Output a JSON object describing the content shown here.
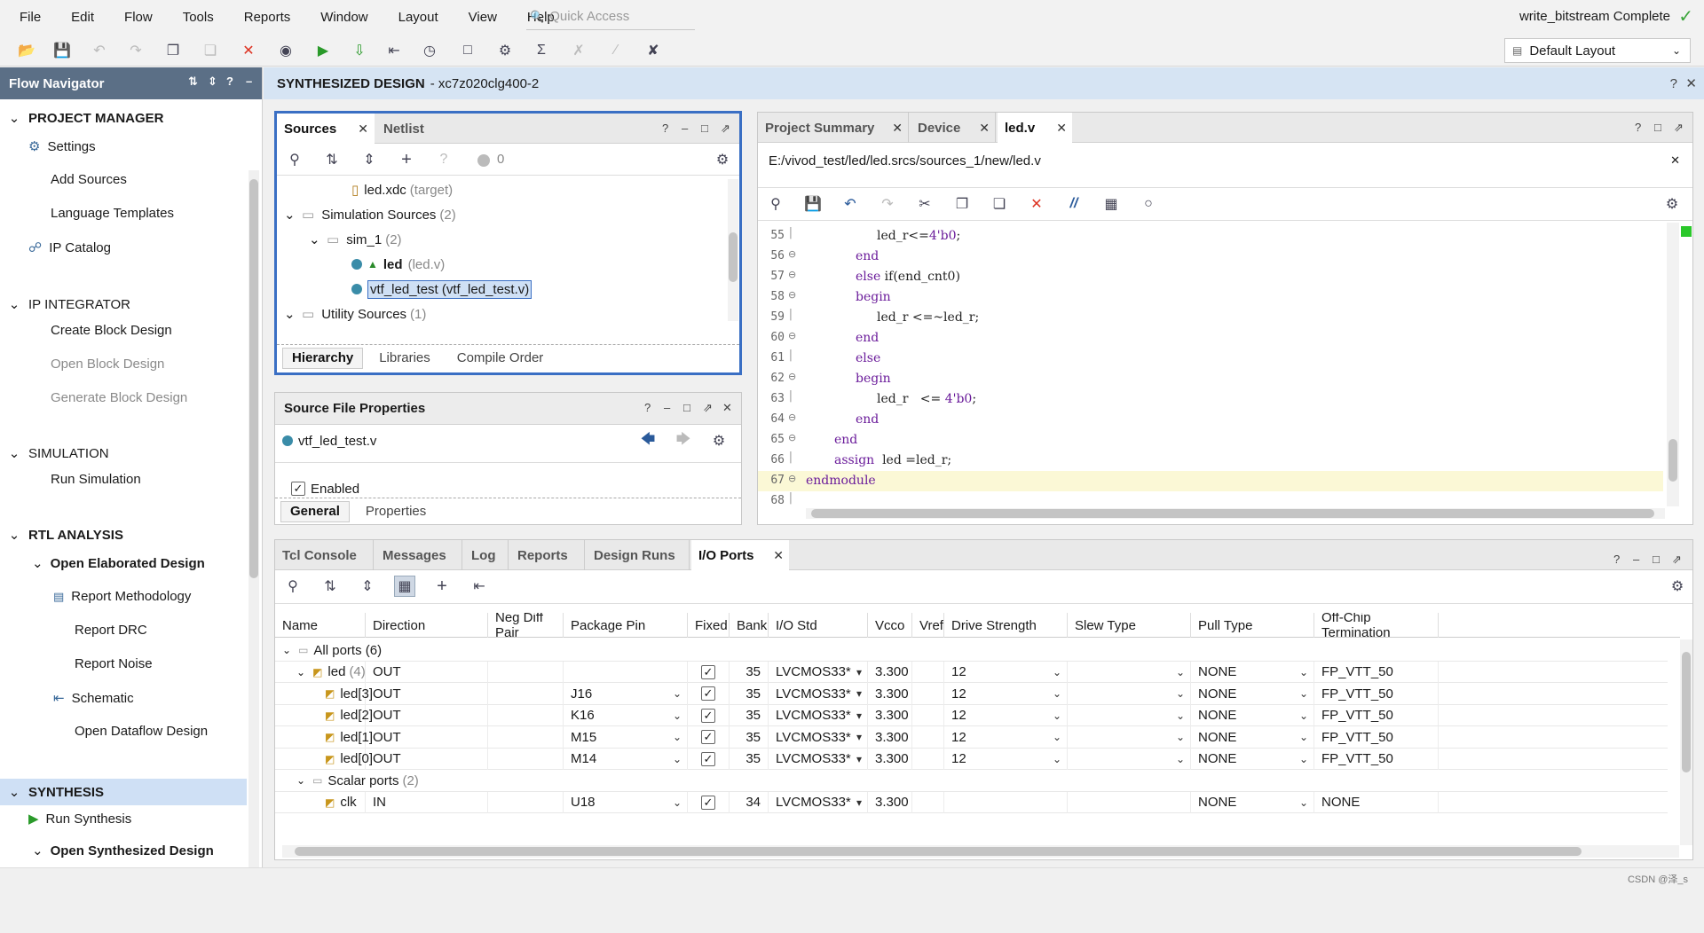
{
  "menu": [
    "File",
    "Edit",
    "Flow",
    "Tools",
    "Reports",
    "Window",
    "Layout",
    "View",
    "Help"
  ],
  "quick_access": {
    "placeholder": "Quick Access"
  },
  "status_right": "write_bitstream Complete",
  "layout_select": "Default Layout",
  "flow_navigator": {
    "title": "Flow Navigator",
    "sections": [
      {
        "title": "PROJECT MANAGER",
        "items": [
          {
            "label": "Settings",
            "icon": "gear"
          },
          {
            "label": "Add Sources"
          },
          {
            "label": "Language Templates"
          },
          {
            "label": "IP Catalog",
            "icon": "plug"
          }
        ]
      },
      {
        "title": "IP INTEGRATOR",
        "items": [
          {
            "label": "Create Block Design"
          },
          {
            "label": "Open Block Design",
            "disabled": true
          },
          {
            "label": "Generate Block Design",
            "disabled": true
          }
        ]
      },
      {
        "title": "SIMULATION",
        "items": [
          {
            "label": "Run Simulation"
          }
        ]
      },
      {
        "title": "RTL ANALYSIS",
        "items": [
          {
            "label": "Open Elaborated Design"
          },
          {
            "label": "Report Methodology",
            "icon": "clipboard"
          },
          {
            "label": "Report DRC"
          },
          {
            "label": "Report Noise"
          },
          {
            "label": "Schematic",
            "icon": "schematic"
          },
          {
            "label": "Open Dataflow Design"
          }
        ]
      },
      {
        "title": "SYNTHESIS",
        "items": [
          {
            "label": "Run Synthesis",
            "icon": "play"
          },
          {
            "label": "Open Synthesized Design"
          }
        ]
      }
    ]
  },
  "design_header": {
    "title": "SYNTHESIZED DESIGN",
    "part": "- xc7z020clg400-2"
  },
  "sources": {
    "tabs": [
      "Sources",
      "Netlist"
    ],
    "count": "0",
    "rows": [
      {
        "name": "led.xdc",
        "suffix": "(target)"
      },
      {
        "name": "Simulation Sources",
        "suffix": "(2)"
      },
      {
        "name": "sim_1",
        "suffix": "(2)"
      },
      {
        "name": "led",
        "suffix": "(led.v)"
      },
      {
        "name": "vtf_led_test (vtf_led_test.v)",
        "suffix": ""
      },
      {
        "name": "Utility Sources",
        "suffix": "(1)"
      }
    ],
    "subtabs": [
      "Hierarchy",
      "Libraries",
      "Compile Order"
    ]
  },
  "source_props": {
    "title": "Source File Properties",
    "file": "vtf_led_test.v",
    "enabled_label": "Enabled",
    "subtabs": [
      "General",
      "Properties"
    ]
  },
  "editor": {
    "tabs": [
      "Project Summary",
      "Device",
      "led.v"
    ],
    "path": "E:/vivod_test/led/led.srcs/sources_1/new/led.v",
    "lines": [
      {
        "n": "55",
        "text": "led_r<=4'b0;"
      },
      {
        "n": "56",
        "text": "end"
      },
      {
        "n": "57",
        "text": "else if(end_cnt0)"
      },
      {
        "n": "58",
        "text": "begin"
      },
      {
        "n": "59",
        "text": "led_r <=~led_r;"
      },
      {
        "n": "60",
        "text": "end"
      },
      {
        "n": "61",
        "text": "else"
      },
      {
        "n": "62",
        "text": "begin"
      },
      {
        "n": "63",
        "text": "led_r   <= 4'b0;"
      },
      {
        "n": "64",
        "text": "end"
      },
      {
        "n": "65",
        "text": "end"
      },
      {
        "n": "66",
        "text": "assign  led =led_r;"
      },
      {
        "n": "67",
        "text": "endmodule"
      },
      {
        "n": "68",
        "text": ""
      }
    ]
  },
  "bottom": {
    "tabs": [
      "Tcl Console",
      "Messages",
      "Log",
      "Reports",
      "Design Runs",
      "I/O Ports"
    ],
    "columns": [
      "Name",
      "Direction",
      "Neg Diff Pair",
      "Package Pin",
      "Fixed",
      "Bank",
      "I/O Std",
      "Vcco",
      "Vref",
      "Drive Strength",
      "Slew Type",
      "Pull Type",
      "Off-Chip Termination"
    ],
    "rows": [
      {
        "name": "All ports (6)",
        "group": true
      },
      {
        "name": "led",
        "suffix": "(4)",
        "dir": "OUT",
        "pin": "",
        "fixed": true,
        "bank": "35",
        "std": "LVCMOS33*",
        "vcco": "3.300",
        "drive": "12",
        "pull": "NONE",
        "term": "FP_VTT_50"
      },
      {
        "name": "led[3]",
        "dir": "OUT",
        "pin": "J16",
        "fixed": true,
        "bank": "35",
        "std": "LVCMOS33*",
        "vcco": "3.300",
        "drive": "12",
        "pull": "NONE",
        "term": "FP_VTT_50"
      },
      {
        "name": "led[2]",
        "dir": "OUT",
        "pin": "K16",
        "fixed": true,
        "bank": "35",
        "std": "LVCMOS33*",
        "vcco": "3.300",
        "drive": "12",
        "pull": "NONE",
        "term": "FP_VTT_50"
      },
      {
        "name": "led[1]",
        "dir": "OUT",
        "pin": "M15",
        "fixed": true,
        "bank": "35",
        "std": "LVCMOS33*",
        "vcco": "3.300",
        "drive": "12",
        "pull": "NONE",
        "term": "FP_VTT_50"
      },
      {
        "name": "led[0]",
        "dir": "OUT",
        "pin": "M14",
        "fixed": true,
        "bank": "35",
        "std": "LVCMOS33*",
        "vcco": "3.300",
        "drive": "12",
        "pull": "NONE",
        "term": "FP_VTT_50"
      },
      {
        "name": "Scalar ports",
        "suffix": "(2)",
        "group": true
      },
      {
        "name": "clk",
        "dir": "IN",
        "pin": "U18",
        "fixed": true,
        "bank": "34",
        "std": "LVCMOS33*",
        "vcco": "3.300",
        "drive": "",
        "pull": "NONE",
        "term": "NONE"
      }
    ]
  },
  "watermark": "CSDN @泽_s",
  "colors": {
    "accent": "#3a6fc4",
    "nav_header": "#5b6f86",
    "design_header": "#d6e4f3",
    "selection": "#cfe0f5"
  }
}
